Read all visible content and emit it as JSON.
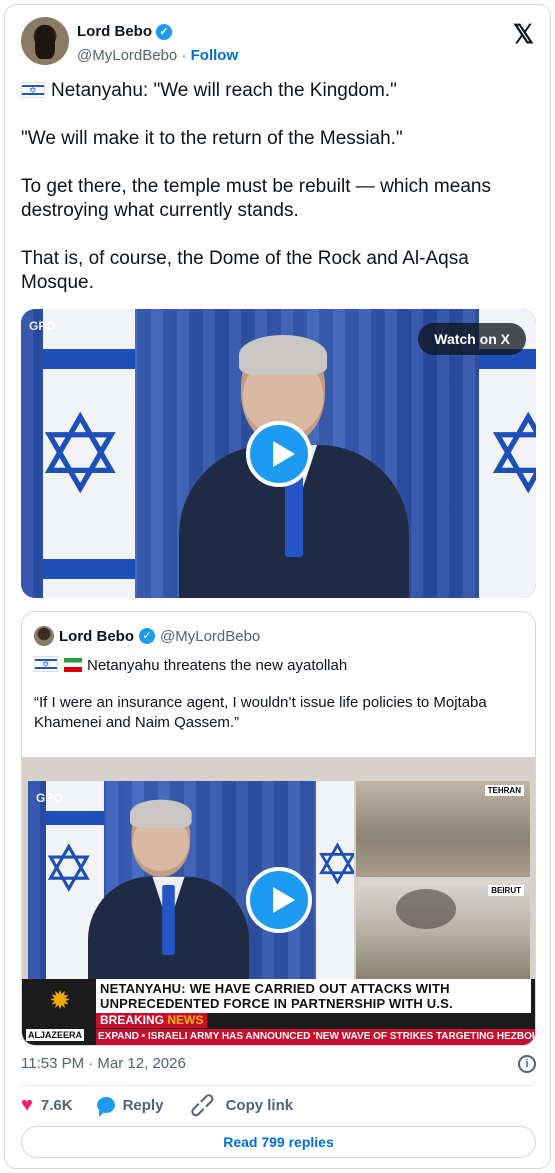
{
  "author": {
    "name": "Lord Bebo",
    "handle": "@MyLordBebo",
    "separator": "·",
    "follow_label": "Follow"
  },
  "x_logo": "𝕏",
  "tweet": {
    "line1": "Netanyahu: \"We will reach the Kingdom.\"",
    "line2": "\"We will make it to the return of the Messiah.\"",
    "line3": "To get there, the temple must be rebuilt — which means destroying what currently stands.",
    "line4": "That is, of course, the Dome of the Rock and Al-Aqsa Mosque."
  },
  "video1": {
    "watch_label": "Watch on X",
    "watermark": "GPO"
  },
  "quoted": {
    "name": "Lord Bebo",
    "handle": "@MyLordBebo",
    "line1": "Netanyahu threatens the new ayatollah",
    "line2": "“If I were an insurance agent, I wouldn’t issue life policies to Mojtaba Khamenei and Naim Qassem.”",
    "video": {
      "watermark": "GPO",
      "tag_tehran": "TEHRAN",
      "tag_beirut": "BEIRUT",
      "headline": "NETANYAHU: WE HAVE CARRIED OUT ATTACKS WITH UNPRECEDENTED FORCE IN PARTNERSHIP WITH U.S.",
      "breaking_1": "BREAKING",
      "breaking_2": "NEWS",
      "channel": "ALJAZEERA",
      "crawl": "EXPAND  •  ISRAELI ARMY HAS ANNOUNCED 'NEW WAVE OF STRIKES TARGETING HEZBOLLAH THROUGHOU"
    }
  },
  "meta": {
    "timestamp": "11:53 PM · Mar 12, 2026",
    "info_icon": "i"
  },
  "actions": {
    "likes": "7.6K",
    "reply_label": "Reply",
    "copy_label": "Copy link"
  },
  "replies_label": "Read 799 replies"
}
